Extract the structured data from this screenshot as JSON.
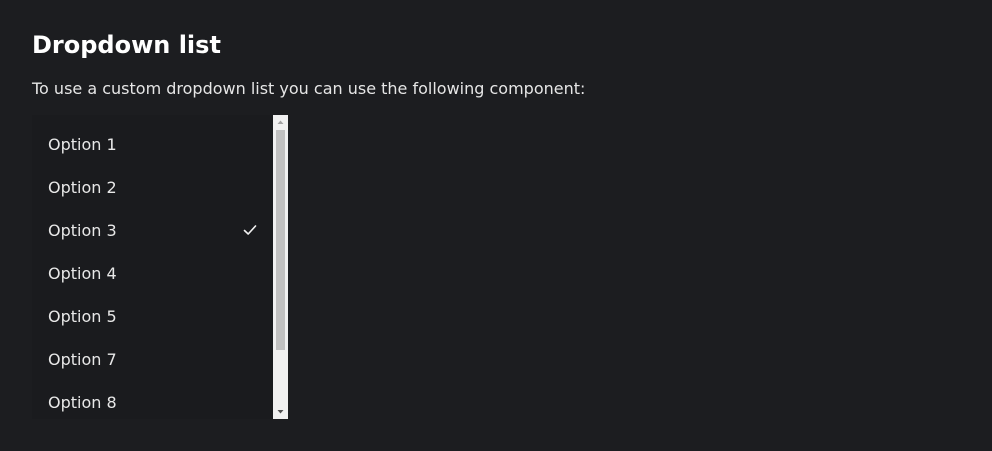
{
  "page": {
    "title": "Dropdown list",
    "intro": "To use a custom dropdown list you can use the following component:"
  },
  "dropdown": {
    "selected": "Option 3",
    "check_icon": "checkmark-icon",
    "options": [
      {
        "label": "Option 1",
        "selected": false
      },
      {
        "label": "Option 2",
        "selected": false
      },
      {
        "label": "Option 3",
        "selected": true
      },
      {
        "label": "Option 4",
        "selected": false
      },
      {
        "label": "Option 5",
        "selected": false
      },
      {
        "label": "Option 7",
        "selected": false
      },
      {
        "label": "Option 8",
        "selected": false
      }
    ]
  },
  "colors": {
    "background": "#1c1d20",
    "list_background": "#1a1b1e",
    "text": "#e8e8e8",
    "scrollbar_track": "#f1f1f1",
    "scrollbar_thumb": "#c1c1c1"
  }
}
